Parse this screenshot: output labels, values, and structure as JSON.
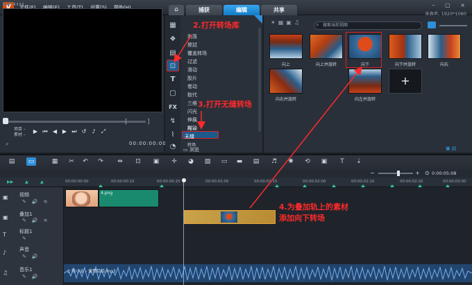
{
  "app": {
    "logo": "V",
    "menu": [
      "文件(F)",
      "编辑(E)",
      "工具(T)",
      "设置(S)",
      "帮助(H)"
    ],
    "tabs": [
      "捕获",
      "编辑",
      "共享"
    ],
    "active_tab": "编辑",
    "window_controls": "– ▢ ×",
    "project_info": "未命名, 1920*1080"
  },
  "preview": {
    "mode_labels": [
      "项目 –",
      "素材 –"
    ],
    "timecode": "00:00:00:00",
    "trim_open": "[",
    "trim_close": "]",
    "controls": [
      "▶",
      "⏮",
      "◀",
      "▶",
      "⏭",
      "↺",
      "🔊",
      "⤢"
    ]
  },
  "library": {
    "icons": [
      "media-icon",
      "instant-project-icon",
      "transition-icon",
      "title-icon",
      "filter-icon",
      "graphic-icon",
      "motion-icon",
      "path-icon",
      "speed-icon"
    ],
    "categories": [
      "剥落",
      "擦拭",
      "覆盖转场",
      "过滤",
      "滑动",
      "胶片",
      "卷动",
      "取代",
      "三维",
      "闪光",
      "伸展",
      "时钟",
      "推动",
      "无缝",
      "转场"
    ],
    "selected_category": "无缝",
    "browse_label": "浏览",
    "search_placeholder": "搜索当前视图",
    "thumbnails": [
      {
        "label": "向上"
      },
      {
        "label": "向上并旋转"
      },
      {
        "label": "向下"
      },
      {
        "label": "向下并旋转"
      },
      {
        "label": "向右"
      },
      {
        "label": "向右并旋转"
      },
      {
        "label": "向左并旋转"
      }
    ],
    "selected_thumbnail": "向下",
    "add_label": "+"
  },
  "annotations": {
    "step2": "2.打开转场库",
    "step3": "3.打开无缝转场",
    "step4_line1": "4.为叠加轨上的素材",
    "step4_line2": "添加向下转场"
  },
  "timeline": {
    "duration": "0:00:05:08",
    "ruler_ticks": [
      "00:00:00:00",
      "00:00:00:10",
      "00:00:00:20",
      "00:00:01:05",
      "00:00:01:15",
      "00:00:02:00",
      "00:00:02:10",
      "00:00:02:20",
      "00:00:03:00"
    ],
    "tracks": [
      {
        "name": "视频",
        "icon": "video-track-icon"
      },
      {
        "name": "叠加1",
        "icon": "overlay-track-icon"
      },
      {
        "name": "标题1",
        "icon": "title-track-icon"
      },
      {
        "name": "声音",
        "icon": "voice-track-icon"
      },
      {
        "name": "音乐1",
        "icon": "music-track-icon"
      }
    ],
    "clips": {
      "video": "4.png",
      "audio": "♫ 陈小云 - 爱情恰恰.mp3"
    }
  },
  "colors": {
    "accent": "#2f8fd9",
    "annotation": "#ff2a2a",
    "video_clip": "#1a8a6e",
    "overlay_clip": "#c9a24a",
    "audio_clip": "#22456e"
  }
}
